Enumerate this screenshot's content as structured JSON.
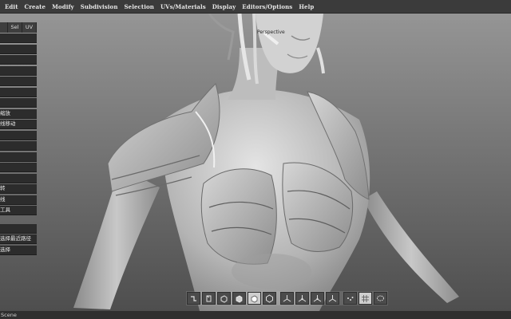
{
  "menubar": {
    "items": [
      "Edit",
      "Create",
      "Modify",
      "Subdivision",
      "Selection",
      "UVs/Materials",
      "Display",
      "Editors/Options",
      "Help"
    ]
  },
  "viewport": {
    "label": "Perspective"
  },
  "left_panel": {
    "tabs": [
      "",
      "Sel",
      "UV"
    ],
    "items_top": [
      "",
      "",
      "",
      "",
      "",
      "",
      "",
      "缩放",
      "线移动",
      "",
      "",
      "",
      "",
      "",
      "转",
      "线",
      "工具"
    ],
    "items_bottom": [
      "",
      "选择最近路径",
      "选择"
    ]
  },
  "bottom_toolbar": {
    "tools": [
      "rotate-tool-icon",
      "cube-front-icon",
      "cube-side-icon",
      "cube-shaded-icon",
      "cube-active-icon",
      "hex-object-icon",
      "axis-xyz-icon",
      "axis-move-icon",
      "axis-scale-icon",
      "axis-rotate-icon",
      "dots-select-icon",
      "grid-icon",
      "lasso-icon"
    ]
  },
  "statusbar": {
    "text": "Scene"
  },
  "colors": {
    "menubar_bg": "#3b3b3b",
    "panel_bg": "#2c2c2c",
    "viewport_bg_top": "#8d8d8d",
    "viewport_bg_bottom": "#525252"
  }
}
